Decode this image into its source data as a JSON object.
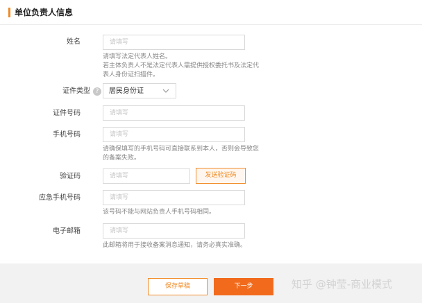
{
  "section": {
    "title": "单位负责人信息"
  },
  "form": {
    "name": {
      "label": "姓名",
      "placeholder": "请填写",
      "hint_line1": "请填写法定代表人姓名。",
      "hint_line2": "若主体负责人不是法定代表人需提供授权委托书及法定代",
      "hint_line3": "表人身份证扫描件。"
    },
    "id_type": {
      "label": "证件类型",
      "help": "?",
      "value": "居民身份证"
    },
    "id_number": {
      "label": "证件号码",
      "placeholder": "请填写"
    },
    "mobile": {
      "label": "手机号码",
      "placeholder": "请填写",
      "hint_line1": "请确保填写的手机号码可直接联系到本人，否则会导致您",
      "hint_line2": "的备案失败。"
    },
    "verify_code": {
      "label": "验证码",
      "placeholder": "请填写",
      "send_button": "发送验证码"
    },
    "emergency_mobile": {
      "label": "应急手机号码",
      "placeholder": "请填写",
      "hint": "该号码不能与网站负责人手机号码相同。"
    },
    "email": {
      "label": "电子邮箱",
      "placeholder": "请填写",
      "hint": "此邮箱将用于接收备案消息通知，请务必真实准确。"
    }
  },
  "footer": {
    "save_label": "保存草稿",
    "next_label": "下一步"
  },
  "watermark": {
    "text": "知乎 @钟莹-商业模式"
  },
  "colors": {
    "accent": "#f08a24",
    "primary_button": "#f26b1d",
    "page_bg": "#f2f2f2"
  },
  "icons": {
    "select_arrow": "chevron-down-icon",
    "help": "question-circle-icon"
  }
}
